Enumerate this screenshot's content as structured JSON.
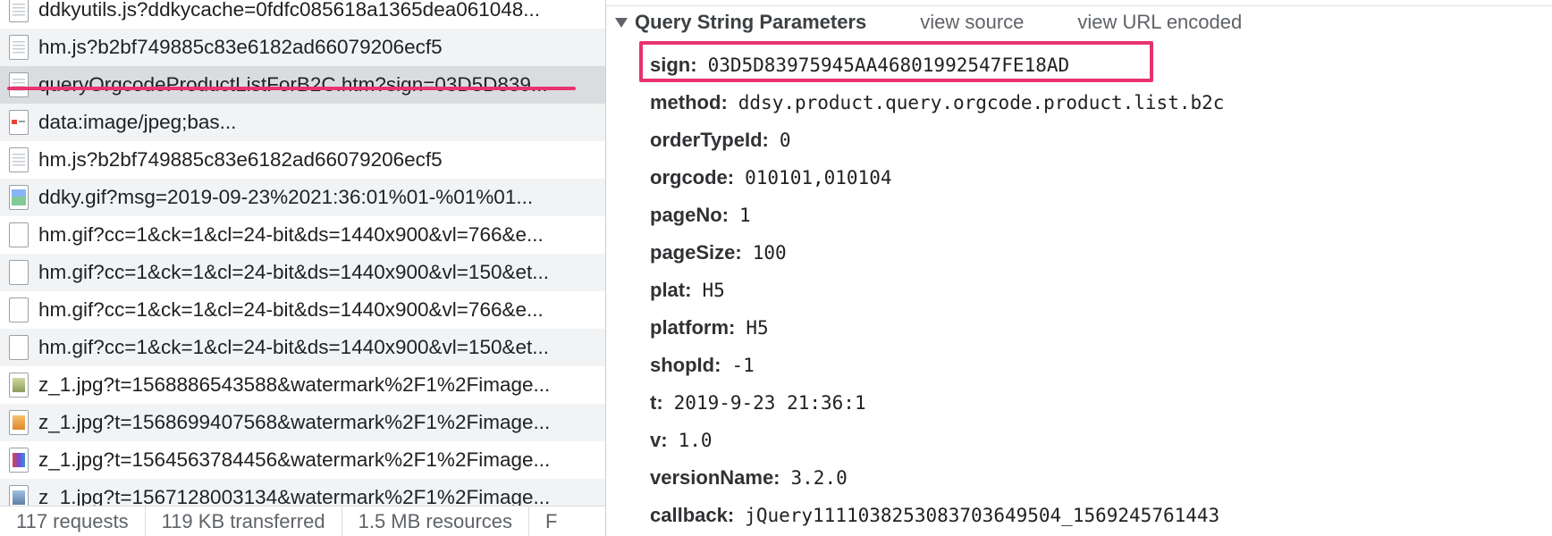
{
  "requests": [
    {
      "name": "ddkyutils.js?ddkycache=0fdfc085618a1365dea061048...",
      "icon": "doc"
    },
    {
      "name": "hm.js?b2bf749885c83e6182ad66079206ecf5",
      "icon": "doc"
    },
    {
      "name": "queryOrgcodeProductListForB2C.htm?sign=03D5D839...",
      "icon": "doc",
      "selected": true
    },
    {
      "name": "data:image/jpeg;bas...",
      "icon": "jpeg"
    },
    {
      "name": "hm.js?b2bf749885c83e6182ad66079206ecf5",
      "icon": "doc"
    },
    {
      "name": "ddky.gif?msg=2019-09-23%2021:36:01%01-%01%01...",
      "icon": "img"
    },
    {
      "name": "hm.gif?cc=1&ck=1&cl=24-bit&ds=1440x900&vl=766&e...",
      "icon": "blank"
    },
    {
      "name": "hm.gif?cc=1&ck=1&cl=24-bit&ds=1440x900&vl=150&et...",
      "icon": "blank"
    },
    {
      "name": "hm.gif?cc=1&ck=1&cl=24-bit&ds=1440x900&vl=766&e...",
      "icon": "blank"
    },
    {
      "name": "hm.gif?cc=1&ck=1&cl=24-bit&ds=1440x900&vl=150&et...",
      "icon": "blank"
    },
    {
      "name": "z_1.jpg?t=1568886543588&watermark%2F1%2Fimage...",
      "icon": "thumb1"
    },
    {
      "name": "z_1.jpg?t=1568699407568&watermark%2F1%2Fimage...",
      "icon": "thumb2"
    },
    {
      "name": "z_1.jpg?t=1564563784456&watermark%2F1%2Fimage...",
      "icon": "thumb3"
    },
    {
      "name": "z_1.jpg?t=1567128003134&watermark%2F1%2Fimage...",
      "icon": "thumb4"
    }
  ],
  "status_bar": {
    "requests": "117 requests",
    "transferred": "119 KB transferred",
    "resources": "1.5 MB resources",
    "finish": "F"
  },
  "query_panel": {
    "title": "Query String Parameters",
    "view_source": "view source",
    "view_url_encoded": "view URL encoded",
    "params": [
      {
        "key": "sign:",
        "value": "03D5D83975945AA46801992547FE18AD"
      },
      {
        "key": "method:",
        "value": "ddsy.product.query.orgcode.product.list.b2c"
      },
      {
        "key": "orderTypeId:",
        "value": "0"
      },
      {
        "key": "orgcode:",
        "value": "010101,010104"
      },
      {
        "key": "pageNo:",
        "value": "1"
      },
      {
        "key": "pageSize:",
        "value": "100"
      },
      {
        "key": "plat:",
        "value": "H5"
      },
      {
        "key": "platform:",
        "value": "H5"
      },
      {
        "key": "shopId:",
        "value": "-1"
      },
      {
        "key": "t:",
        "value": "2019-9-23 21:36:1"
      },
      {
        "key": "v:",
        "value": "1.0"
      },
      {
        "key": "versionName:",
        "value": "3.2.0"
      },
      {
        "key": "callback:",
        "value": "jQuery1111038253083703649504_1569245761443"
      }
    ]
  },
  "colors": {
    "annotation": "#e8336d",
    "selected_row": "#dadce0",
    "alt_row": "#f1f3f4"
  }
}
